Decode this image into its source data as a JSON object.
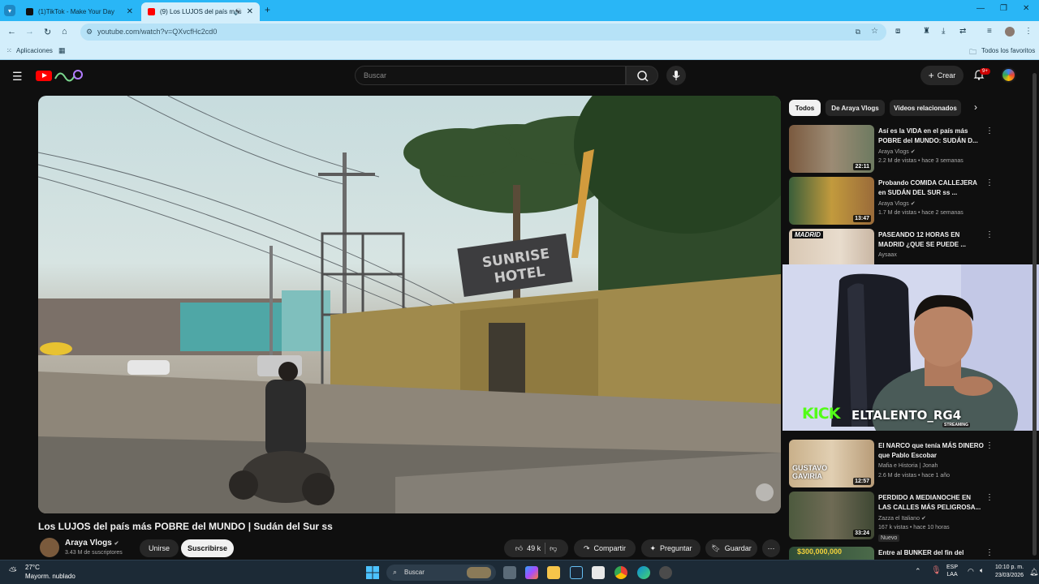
{
  "browser": {
    "tabs": [
      {
        "label": "(1)TikTok - Make Your Day",
        "active": false
      },
      {
        "label": "(9) Los LUJOS del país más",
        "active": true
      }
    ],
    "url": "youtube.com/watch?v=QXvcfHc2cd0",
    "bookmarks": {
      "apps_label": "Aplicaciones",
      "all_favorites_label": "Todos los favoritos"
    }
  },
  "youtube": {
    "search_placeholder": "Buscar",
    "create_label": "Crear",
    "notifications_count": "9+"
  },
  "video": {
    "scene_text": "SUNRISE HOTEL",
    "title": "Los LUJOS del país más POBRE del MUNDO | Sudán del Sur ss",
    "channel": "Araya Vlogs",
    "subscribers": "3.43 M de suscriptores",
    "join_label": "Unirse",
    "subscribe_label": "Suscribirse",
    "likes": "49 k",
    "share_label": "Compartir",
    "ask_label": "Preguntar",
    "save_label": "Guardar"
  },
  "sidebar": {
    "chips": [
      "Todos",
      "De Araya Vlogs",
      "Videos relacionados"
    ],
    "recommendations": [
      {
        "title": "Así es la VIDA en el país más POBRE del MUNDO: SUDÁN D...",
        "channel": "Araya Vlogs",
        "meta": "2.2 M de vistas • hace 3 semanas",
        "duration": "22:11"
      },
      {
        "title": "Probando COMIDA CALLEJERA en SUDÁN DEL SUR ss ...",
        "channel": "Araya Vlogs",
        "meta": "1.7 M de vistas • hace 2 semanas",
        "duration": "13:47"
      },
      {
        "title": "PASEANDO 12 HORAS EN MADRID ¿QUE SE PUEDE ...",
        "channel": "Aysaax",
        "meta": "",
        "duration": "",
        "thumb_text": "MADRID"
      },
      {
        "title": "El NARCO que tenía MÁS DINERO que Pablo Escobar",
        "channel": "Mafia e Historia | Jonah",
        "meta": "2.6 M de vistas • hace 1 año",
        "duration": "12:57",
        "thumb_text": "GUSTAVO GAVIRIA"
      },
      {
        "title": "PERDIDO A MEDIANOCHE EN LAS CALLES MÁS PELIGROSA...",
        "channel": "Zazza el Italiano",
        "meta": "167 k vistas • hace 10 horas",
        "duration": "33:24",
        "badge": "Nuevo"
      },
      {
        "title": "Entre al BUNKER del fin del",
        "channel": "",
        "meta": "",
        "duration": "",
        "thumb_text": "$300,000,000"
      }
    ]
  },
  "overlay": {
    "kick_label": "KICK",
    "streamer_label": "ELTALENTO_RG4",
    "sticker_label": "STREAMING"
  },
  "taskbar": {
    "temperature": "27°C",
    "weather": "Mayorm. nublado",
    "search_label": "Buscar",
    "language": "ESP",
    "region": "LAA",
    "time": "10:10 p. m.",
    "date": "23/03/2026"
  }
}
